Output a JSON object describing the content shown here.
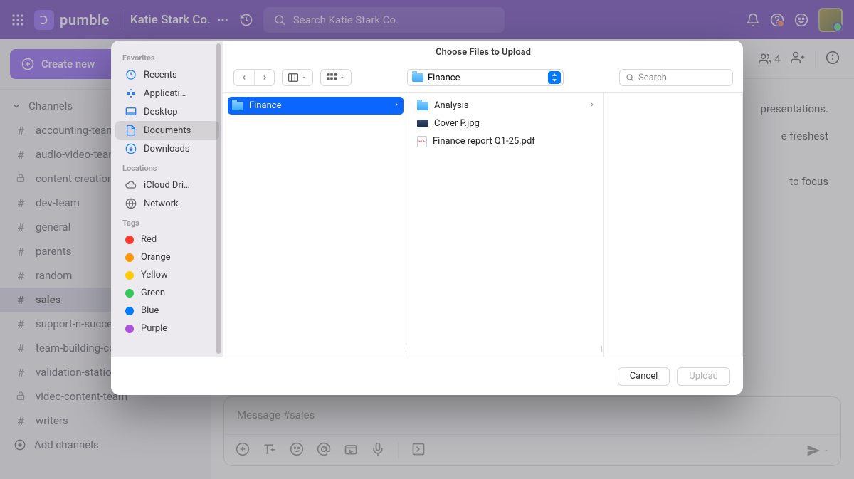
{
  "header": {
    "logo_text": "pumble",
    "workspace_name": "Katie Stark Co.",
    "search_placeholder": "Search Katie Stark Co.",
    "member_count": "4"
  },
  "sidebar": {
    "create_new_label": "Create new",
    "channels_label": "Channels",
    "add_channels_label": "Add channels",
    "channels": [
      {
        "name": "accounting-team",
        "locked": false
      },
      {
        "name": "audio-video-team",
        "locked": false
      },
      {
        "name": "content-creation",
        "locked": true
      },
      {
        "name": "dev-team",
        "locked": false
      },
      {
        "name": "general",
        "locked": false
      },
      {
        "name": "parents",
        "locked": false
      },
      {
        "name": "random",
        "locked": false
      },
      {
        "name": "sales",
        "locked": false,
        "selected": true
      },
      {
        "name": "support-n-success",
        "locked": false
      },
      {
        "name": "team-building-committee",
        "locked": false
      },
      {
        "name": "validation-station",
        "locked": false
      },
      {
        "name": "video-content-team",
        "locked": true
      },
      {
        "name": "writers",
        "locked": false
      }
    ]
  },
  "chat": {
    "body_line1": " presentations.",
    "body_line2": "e freshest",
    "body_line3": " to focus",
    "composer_placeholder": "Message #sales"
  },
  "picker": {
    "title": "Choose Files to Upload",
    "current_folder": "Finance",
    "search_placeholder": "Search",
    "cancel_label": "Cancel",
    "upload_label": "Upload",
    "sidebar_groups": [
      {
        "title": "Favorites",
        "items": [
          {
            "name": "Recents",
            "icon": "clock"
          },
          {
            "name": "Applicati…",
            "icon": "app"
          },
          {
            "name": "Desktop",
            "icon": "desktop"
          },
          {
            "name": "Documents",
            "icon": "doc",
            "selected": true
          },
          {
            "name": "Downloads",
            "icon": "download"
          }
        ]
      },
      {
        "title": "Locations",
        "items": [
          {
            "name": "iCloud Dri…",
            "icon": "cloud"
          },
          {
            "name": "Network",
            "icon": "globe"
          }
        ]
      },
      {
        "title": "Tags",
        "items": [
          {
            "name": "Red",
            "icon": "tag",
            "color": "#ff3b30"
          },
          {
            "name": "Orange",
            "icon": "tag",
            "color": "#ff9500"
          },
          {
            "name": "Yellow",
            "icon": "tag",
            "color": "#ffcc00"
          },
          {
            "name": "Green",
            "icon": "tag",
            "color": "#34c759"
          },
          {
            "name": "Blue",
            "icon": "tag",
            "color": "#007aff"
          },
          {
            "name": "Purple",
            "icon": "tag",
            "color": "#af52de"
          }
        ]
      }
    ],
    "column1": [
      {
        "name": "Finance",
        "icon": "folder",
        "selected": true,
        "chevron": true
      }
    ],
    "column2": [
      {
        "name": "Analysis",
        "icon": "folder",
        "chevron": true
      },
      {
        "name": "Cover P.jpg",
        "icon": "image"
      },
      {
        "name": "Finance report Q1-25.pdf",
        "icon": "pdf"
      }
    ]
  }
}
